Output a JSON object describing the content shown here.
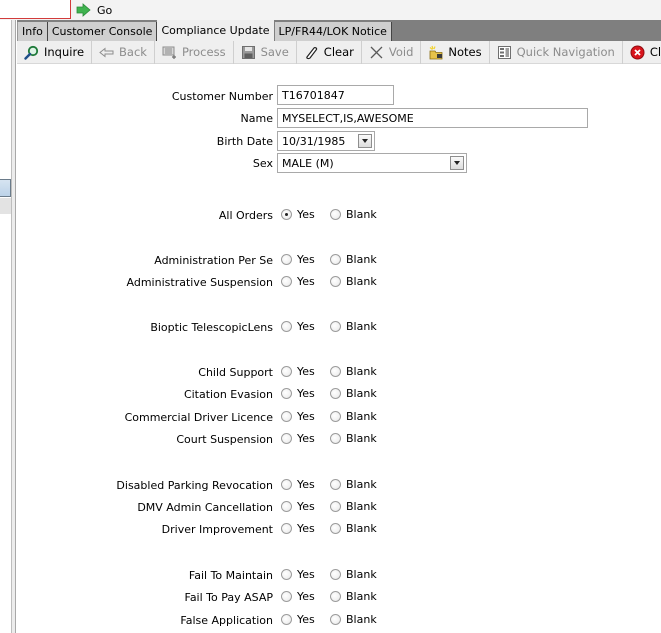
{
  "topbar": {
    "go_label": "Go"
  },
  "tabs": [
    {
      "label": "Info",
      "active": false
    },
    {
      "label": "Customer Console",
      "active": false
    },
    {
      "label": "Compliance Update",
      "active": true
    },
    {
      "label": "LP/FR44/LOK Notice",
      "active": false
    }
  ],
  "toolbar": {
    "inquire": "Inquire",
    "back": "Back",
    "process": "Process",
    "save": "Save",
    "clear": "Clear",
    "void": "Void",
    "notes": "Notes",
    "quick_navigation": "Quick Navigation",
    "close": "Close"
  },
  "form": {
    "customer_number": {
      "label": "Customer Number",
      "value": "T16701847"
    },
    "name": {
      "label": "Name",
      "value": "MYSELECT,IS,AWESOME"
    },
    "birth_date": {
      "label": "Birth Date",
      "value": "10/31/1985"
    },
    "sex": {
      "label": "Sex",
      "value": "MALE (M)"
    },
    "option_yes": "Yes",
    "option_blank": "Blank",
    "flags": [
      {
        "label": "All Orders",
        "selected": "Yes"
      },
      {
        "label": "Administration Per Se",
        "selected": null
      },
      {
        "label": "Administrative Suspension",
        "selected": null
      },
      {
        "label": "Bioptic TelescopicLens",
        "selected": null
      },
      {
        "label": "Child Support",
        "selected": null
      },
      {
        "label": "Citation Evasion",
        "selected": null
      },
      {
        "label": "Commercial Driver Licence",
        "selected": null
      },
      {
        "label": "Court Suspension",
        "selected": null
      },
      {
        "label": "Disabled Parking Revocation",
        "selected": null
      },
      {
        "label": "DMV Admin Cancellation",
        "selected": null
      },
      {
        "label": "Driver Improvement",
        "selected": null
      },
      {
        "label": "Fail To Maintain",
        "selected": null
      },
      {
        "label": "Fail To Pay ASAP",
        "selected": null
      },
      {
        "label": "False Application",
        "selected": null
      }
    ]
  }
}
